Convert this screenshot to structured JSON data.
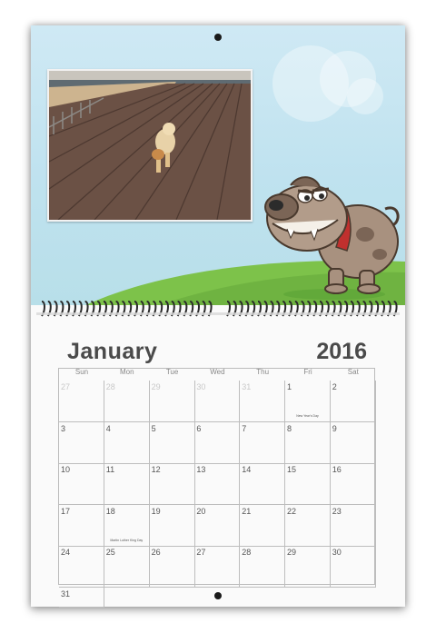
{
  "calendar": {
    "month": "January",
    "year": "2016",
    "weekdays": [
      "Sun",
      "Mon",
      "Tue",
      "Wed",
      "Thu",
      "Fri",
      "Sat"
    ],
    "weeks": [
      [
        {
          "d": "27",
          "out": true
        },
        {
          "d": "28",
          "out": true
        },
        {
          "d": "29",
          "out": true
        },
        {
          "d": "30",
          "out": true
        },
        {
          "d": "31",
          "out": true
        },
        {
          "d": "1",
          "note": "New Year's Day"
        },
        {
          "d": "2"
        }
      ],
      [
        {
          "d": "3"
        },
        {
          "d": "4"
        },
        {
          "d": "5"
        },
        {
          "d": "6"
        },
        {
          "d": "7"
        },
        {
          "d": "8"
        },
        {
          "d": "9"
        }
      ],
      [
        {
          "d": "10"
        },
        {
          "d": "11"
        },
        {
          "d": "12"
        },
        {
          "d": "13"
        },
        {
          "d": "14"
        },
        {
          "d": "15"
        },
        {
          "d": "16"
        }
      ],
      [
        {
          "d": "17"
        },
        {
          "d": "18",
          "note": "Martin Luther King Day"
        },
        {
          "d": "19"
        },
        {
          "d": "20"
        },
        {
          "d": "21"
        },
        {
          "d": "22"
        },
        {
          "d": "23"
        }
      ],
      [
        {
          "d": "24"
        },
        {
          "d": "25"
        },
        {
          "d": "26"
        },
        {
          "d": "27"
        },
        {
          "d": "28"
        },
        {
          "d": "29"
        },
        {
          "d": "30"
        }
      ],
      [
        {
          "d": "31"
        }
      ]
    ]
  },
  "colors": {
    "sky": "#c4e4f0",
    "grass": "#7dc24a",
    "text": "#4a4a4a"
  },
  "illustrations": {
    "photo": "dog-on-boardwalk-photo",
    "cartoon": "cartoon-bulldog-icon"
  }
}
